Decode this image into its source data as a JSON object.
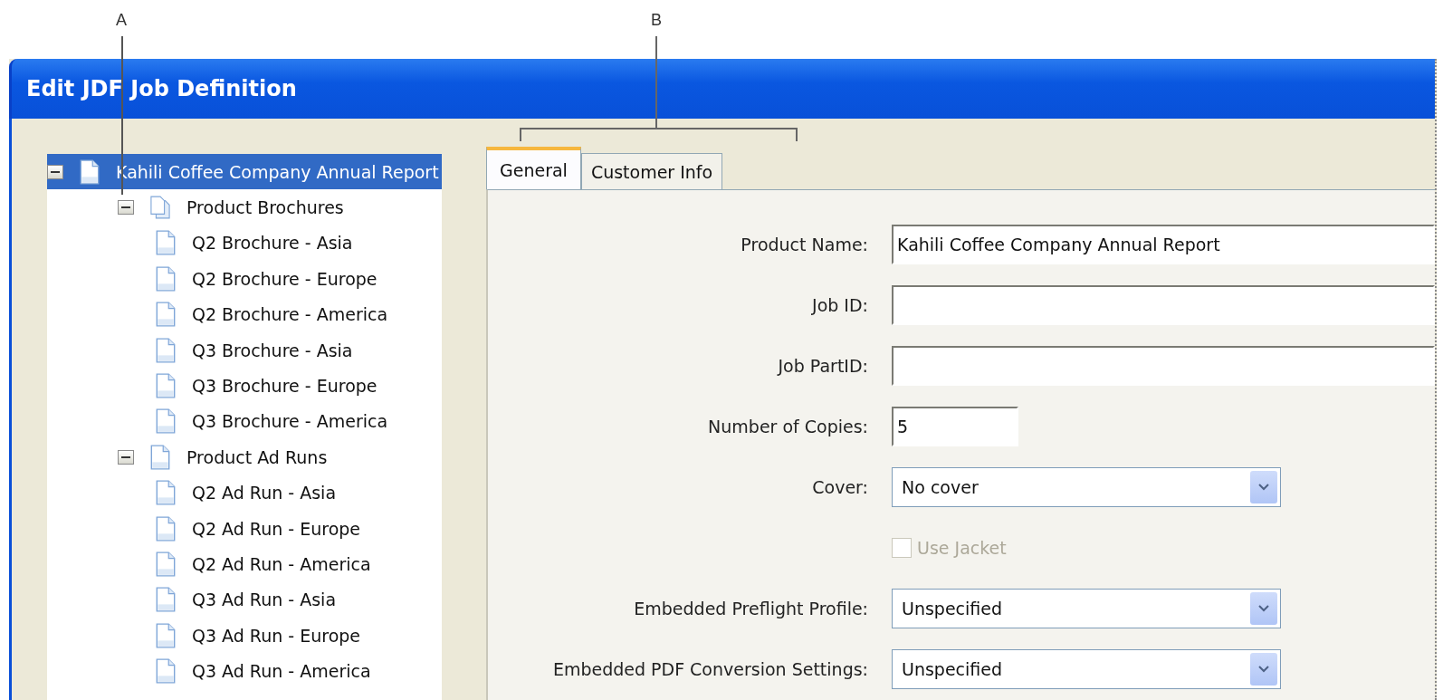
{
  "callouts": [
    {
      "label": "A"
    },
    {
      "label": "B"
    }
  ],
  "window": {
    "title": "Edit JDF Job Definition"
  },
  "tree": [
    {
      "label": "Kahili Coffee Company Annual Report",
      "selected": true,
      "expanded": true,
      "kind": "document",
      "children": [
        {
          "label": "Product Brochures",
          "selected": false,
          "expanded": true,
          "kind": "stack",
          "children": [
            {
              "label": "Q2 Brochure - Asia",
              "selected": false,
              "kind": "document"
            },
            {
              "label": "Q2 Brochure - Europe",
              "selected": false,
              "kind": "document"
            },
            {
              "label": "Q2 Brochure - America",
              "selected": false,
              "kind": "document"
            },
            {
              "label": "Q3 Brochure - Asia",
              "selected": false,
              "kind": "document"
            },
            {
              "label": "Q3 Brochure - Europe",
              "selected": false,
              "kind": "document"
            },
            {
              "label": "Q3 Brochure - America",
              "selected": false,
              "kind": "document"
            }
          ]
        },
        {
          "label": "Product Ad Runs",
          "selected": false,
          "expanded": true,
          "kind": "document",
          "children": [
            {
              "label": "Q2 Ad Run - Asia",
              "selected": false,
              "kind": "document"
            },
            {
              "label": "Q2 Ad Run - Europe",
              "selected": false,
              "kind": "document"
            },
            {
              "label": "Q2 Ad Run - America",
              "selected": false,
              "kind": "document"
            },
            {
              "label": "Q3 Ad Run - Asia",
              "selected": false,
              "kind": "document"
            },
            {
              "label": "Q3 Ad Run - Europe",
              "selected": false,
              "kind": "document"
            },
            {
              "label": "Q3 Ad Run - America",
              "selected": false,
              "kind": "document"
            }
          ]
        }
      ]
    }
  ],
  "tabs": [
    {
      "label": "General",
      "selected": true
    },
    {
      "label": "Customer Info",
      "selected": false
    }
  ],
  "fields": [
    {
      "kind": "text",
      "label": "Product Name:",
      "value": "Kahili Coffee Company Annual Report"
    },
    {
      "kind": "text",
      "label": "Job ID:"
    },
    {
      "kind": "text",
      "label": "Job PartID:"
    },
    {
      "kind": "number",
      "label": "Number of Copies:",
      "value": "5"
    },
    {
      "kind": "dropdown",
      "label": "Cover:",
      "value": "No cover"
    },
    {
      "kind": "checkbox",
      "label": "Use Jacket",
      "checked": false,
      "disabled": true
    },
    {
      "kind": "dropdown",
      "label": "Embedded Preflight Profile:",
      "value": "Unspecified"
    },
    {
      "kind": "dropdown",
      "label": "Embedded PDF Conversion Settings:",
      "value": "Unspecified"
    }
  ]
}
